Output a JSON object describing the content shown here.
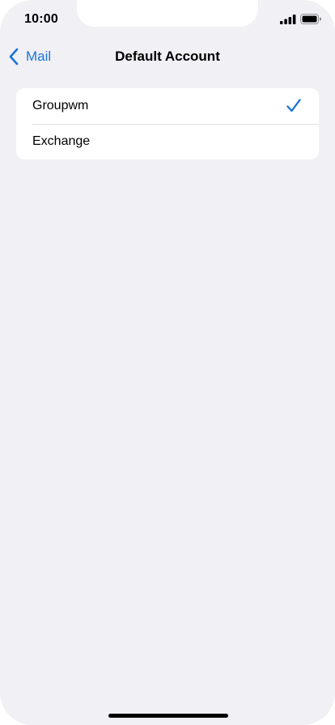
{
  "status_bar": {
    "time": "10:00",
    "signal_icon": "cellular-signal-icon",
    "battery_icon": "battery-icon"
  },
  "nav": {
    "back_label": "Mail",
    "back_icon": "chevron-left-icon",
    "title": "Default Account"
  },
  "accounts": {
    "items": [
      {
        "label": "Groupwm",
        "selected": true
      },
      {
        "label": "Exchange",
        "selected": false
      }
    ],
    "selected_icon": "checkmark-icon"
  },
  "colors": {
    "accent": "#1a73d9",
    "background": "#f0f0f5",
    "card": "#ffffff"
  }
}
